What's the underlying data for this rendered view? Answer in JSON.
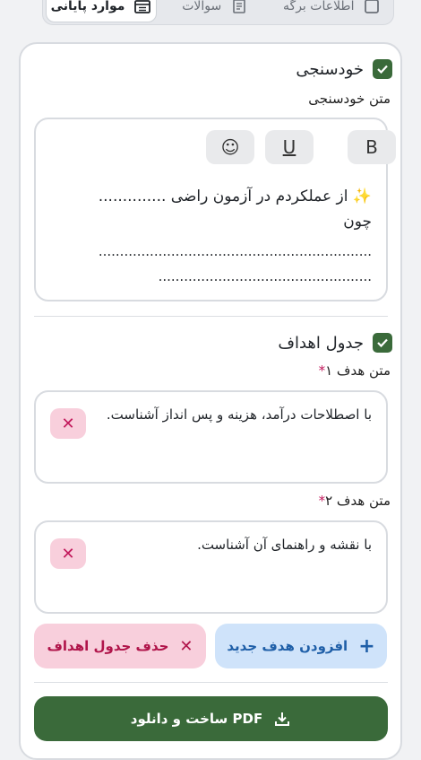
{
  "tabs": [
    {
      "label": "اطلاعات برگه",
      "icon": "square-icon"
    },
    {
      "label": "سوالات",
      "icon": "list-icon"
    },
    {
      "label": "موارد پایانی",
      "icon": "calendar-icon",
      "active": true
    }
  ],
  "self_assessment": {
    "title": "خودسنجی",
    "label": "متن خودسنجی",
    "tools": {
      "bold": "B",
      "underline": "U",
      "emoji": "☺"
    },
    "text_line1": "✨ از عملکردم در آزمون راضی ..............",
    "text_line2": "چون",
    "text_line3": "................................................................",
    "text_line4": ".................................................."
  },
  "goals": {
    "title": "جدول اهداف",
    "goal1_label": "متن هدف ۱",
    "goal1_text": "با اصطلاحات درآمد، هزینه و پس انداز آشناست.",
    "goal2_label": "متن هدف ۲",
    "goal2_text": "با نقشه و راهنمای آن آشناست.",
    "required_mark": "*",
    "remove_symbol": "✕"
  },
  "buttons": {
    "add_goal": "افزودن هدف جدید",
    "delete_goals": "حذف جدول اهداف",
    "build_pdf": "ساخت و دانلود PDF"
  },
  "colors": {
    "primary_green": "#3a6a3a",
    "add_blue": "#cfe3fa",
    "delete_pink": "#f8cfdc"
  }
}
